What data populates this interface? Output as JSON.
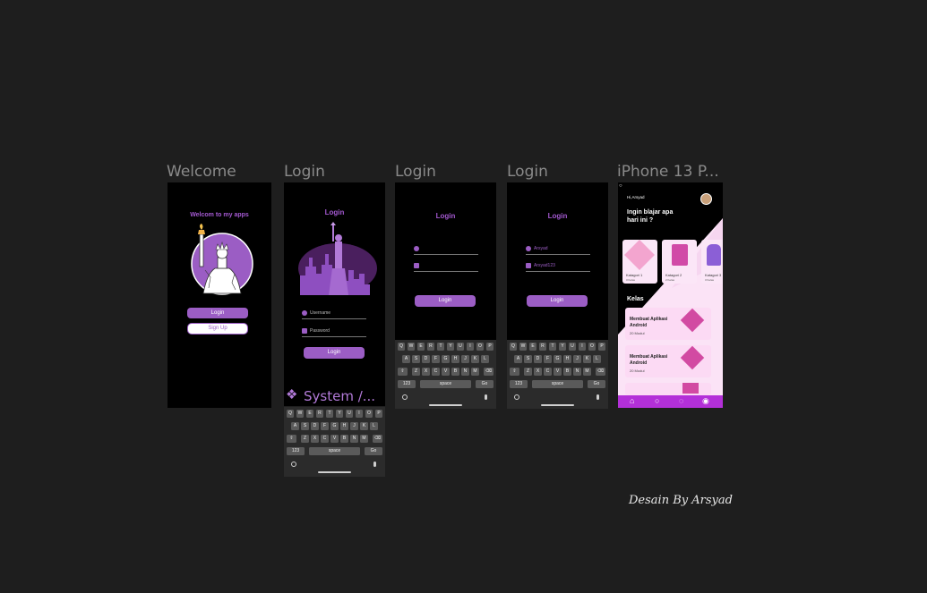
{
  "frames": {
    "welcome": {
      "label": "Welcome",
      "heading": "Welcom to my apps",
      "login": "Login",
      "signup": "Sign Up"
    },
    "login1": {
      "label": "Login",
      "title": "Login",
      "username_placeholder": "Username",
      "password_placeholder": "Password",
      "button": "Login",
      "system_text": "System /..."
    },
    "login2": {
      "label": "Login",
      "title": "Login",
      "button": "Login"
    },
    "login3": {
      "label": "Login",
      "title": "Login",
      "username_value": "Arsyad",
      "password_value": "Arsyad123",
      "button": "Login"
    },
    "home": {
      "label": "iPhone 13 P...",
      "greeting": "Hi,Arsyad",
      "prompt_line1": "Ingin blajar apa",
      "prompt_line2": "hari ini ?",
      "categories": [
        {
          "name": "Katagori 1",
          "sub": "3 Kelas"
        },
        {
          "name": "Katagori 2",
          "sub": "2 Kelas"
        },
        {
          "name": "Katagori 3",
          "sub": "3 Kelas"
        }
      ],
      "section": "Kelas",
      "courses": [
        {
          "title_1": "Membuat Aplikasi",
          "title_2": "Android",
          "modules": "20 Modul"
        },
        {
          "title_1": "Membuat Aplikasi",
          "title_2": "Android",
          "modules": "20 Modul"
        }
      ]
    }
  },
  "keyboard": {
    "row1": [
      "Q",
      "W",
      "E",
      "R",
      "T",
      "Y",
      "U",
      "I",
      "O",
      "P"
    ],
    "row2": [
      "A",
      "S",
      "D",
      "F",
      "G",
      "H",
      "J",
      "K",
      "L"
    ],
    "row3": [
      "Z",
      "X",
      "C",
      "V",
      "B",
      "N",
      "M"
    ],
    "shift": "⇧",
    "backspace": "⌫",
    "numbers": "123",
    "space": "space",
    "go": "Go"
  },
  "credit": "Desain By Arsyad",
  "colors": {
    "accent": "#9b5dc4",
    "background": "#1e1e1e",
    "frame": "#000000",
    "nav": "#b330d8"
  }
}
